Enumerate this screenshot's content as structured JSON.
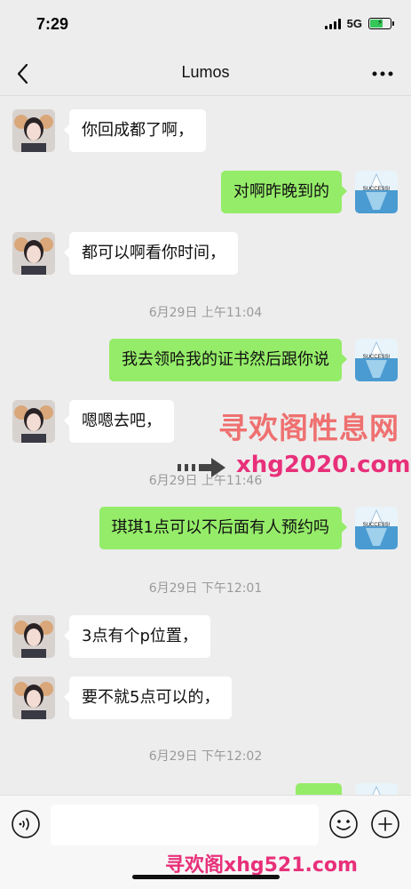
{
  "status_bar": {
    "time": "7:29",
    "network": "5G"
  },
  "nav": {
    "title": "Lumos"
  },
  "messages": [
    {
      "side": "left",
      "text": "你回成都了啊，"
    },
    {
      "side": "right",
      "text": "对啊昨晚到的"
    },
    {
      "side": "left",
      "text": "都可以啊看你时间，"
    },
    {
      "timestamp": "6月29日 上午11:04"
    },
    {
      "side": "right",
      "text": "我去领哈我的证书然后跟你说"
    },
    {
      "side": "left",
      "text": "嗯嗯去吧，"
    },
    {
      "timestamp": "6月29日 上午11:46"
    },
    {
      "side": "right",
      "text": "琪琪1点可以不后面有人预约吗"
    },
    {
      "timestamp": "6月29日 下午12:01"
    },
    {
      "side": "left",
      "text": "3点有个p位置，"
    },
    {
      "side": "left",
      "text": "要不就5点可以的，"
    },
    {
      "timestamp": "6月29日 下午12:02"
    }
  ],
  "self_avatar": {
    "caption": "SUCCESS!"
  },
  "watermarks": {
    "line1": "寻欢阁性息网",
    "line2": "xhg2020.com",
    "line3": "寻欢阁xhg521.com"
  },
  "colors": {
    "background": "#ededed",
    "self_bubble": "#95ec69",
    "other_bubble": "#ffffff",
    "watermark_pink": "#e8307a"
  },
  "icons": {
    "back": "chevron-left-icon",
    "more": "more-horizontal-icon",
    "voice": "voice-icon",
    "emoji": "emoji-icon",
    "plus": "plus-icon"
  }
}
